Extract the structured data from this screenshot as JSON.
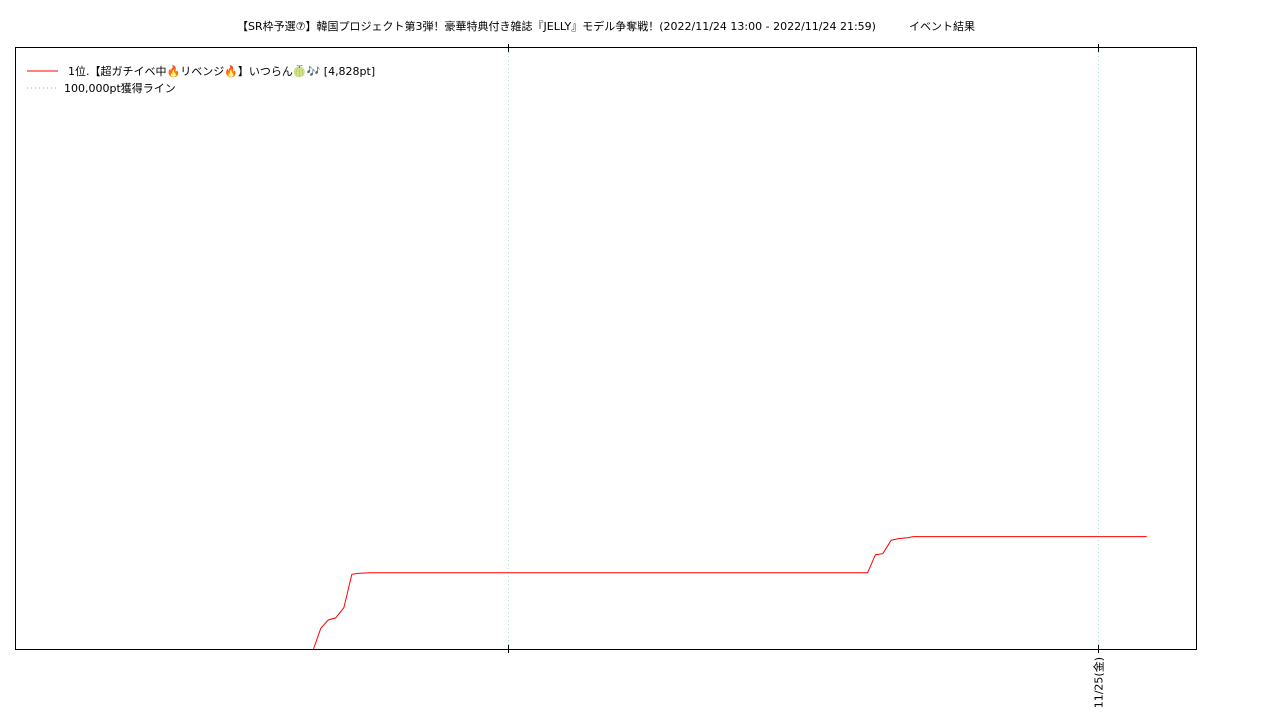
{
  "chart_data": {
    "type": "line",
    "title": "【SR枠予選⑦】韓国プロジェクト第3弾！豪華特典付き雑誌『JELLY』モデル争奪戦！(2022/11/24 13:00 - 2022/11/24 21:59)　　　イベント結果",
    "xlabel": "",
    "ylabel": "",
    "x_unit": "hours since 2022/11/24 00:00",
    "xlim": [
      0.3,
      24.3
    ],
    "ylim": [
      0,
      5800
    ],
    "grid": true,
    "grid_style": "dotted vertical",
    "legend_position": "top-left",
    "x_ticks": [
      {
        "x": 10.3,
        "label": ""
      },
      {
        "x": 22.3,
        "label": "11/25(金)"
      }
    ],
    "series": [
      {
        "name": "1位.【超ガチイベ中🔥リベンジ🔥】いつらん🍈🎶 [4,828pt]",
        "color": "#ff0000",
        "style": "solid",
        "x": [
          6.35,
          6.5,
          6.65,
          6.8,
          6.97,
          7.13,
          7.25,
          7.5,
          17.62,
          17.78,
          17.93,
          18.1,
          18.25,
          18.45,
          18.55,
          18.7,
          23.3
        ],
        "y": [
          0,
          200,
          280,
          300,
          400,
          720,
          730,
          735,
          735,
          910,
          920,
          1050,
          1065,
          1075,
          1085,
          1085,
          1085
        ]
      },
      {
        "name": "100,000pt獲得ライン",
        "color": "#aaaaaa",
        "style": "dotted",
        "x": [],
        "y": []
      }
    ]
  }
}
